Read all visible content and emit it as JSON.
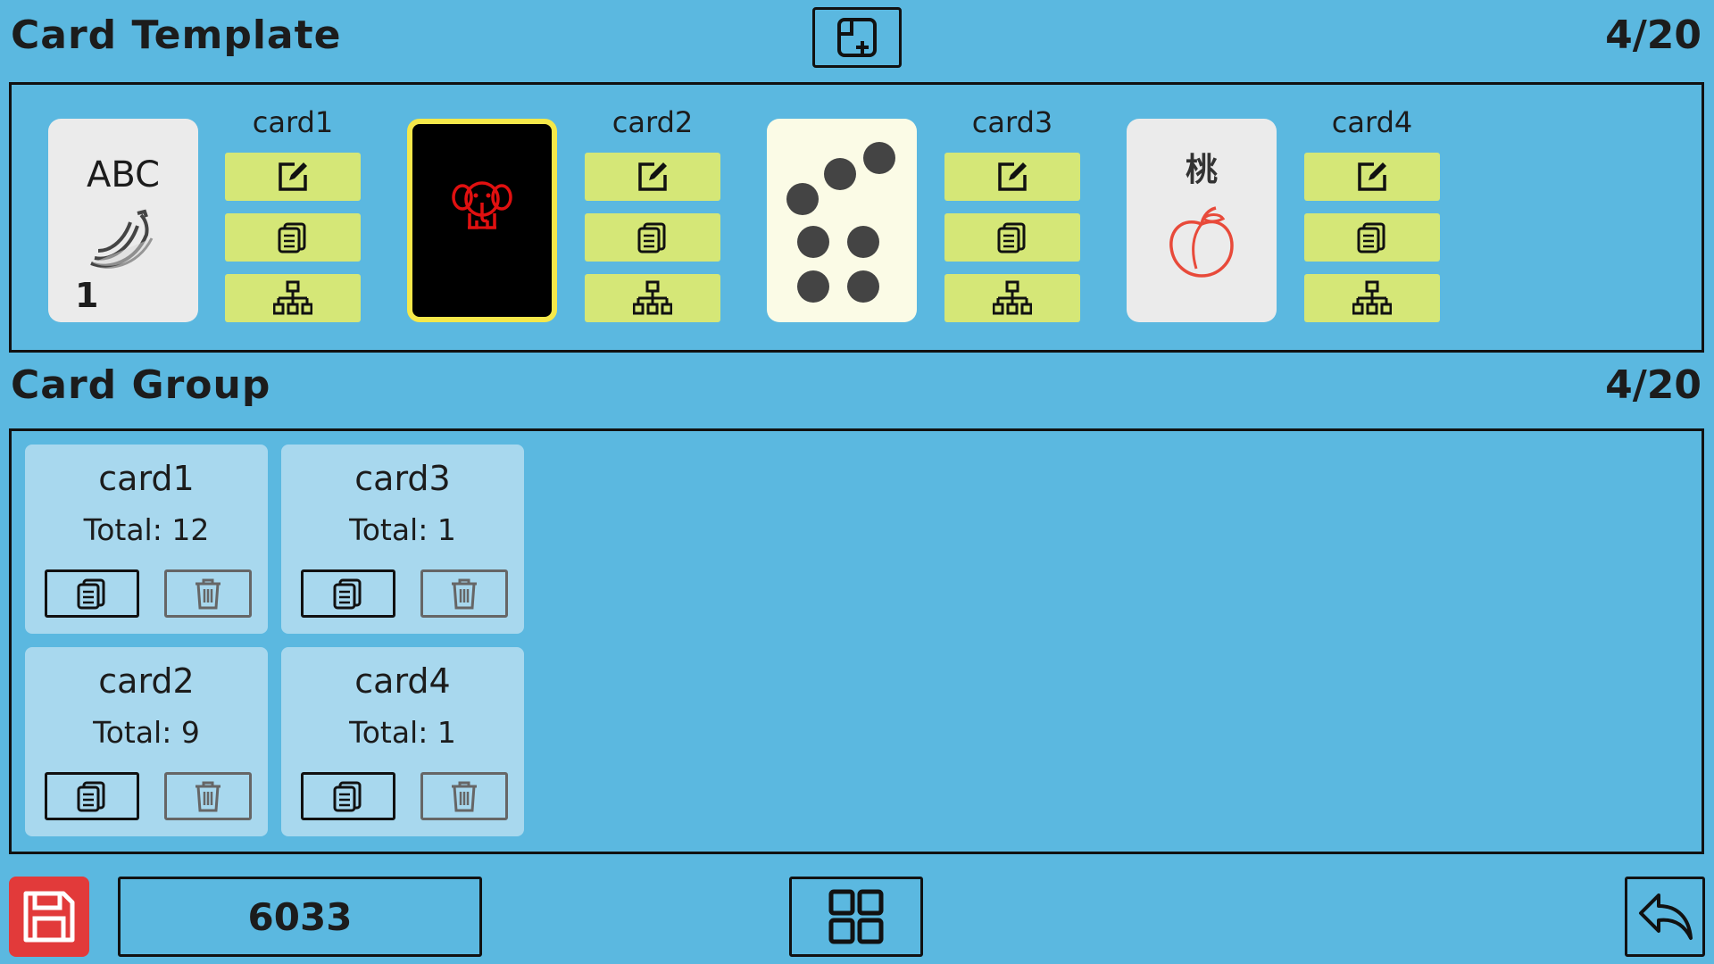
{
  "header": {
    "template_title": "Card Template",
    "template_count": "4/20",
    "group_title": "Card Group",
    "group_count": "4/20"
  },
  "templates": [
    {
      "name": "card1",
      "face": {
        "text": "ABC",
        "number": "1",
        "icon": "banana-icon"
      }
    },
    {
      "name": "card2",
      "face": {
        "icon": "elephant-icon",
        "selected": true
      }
    },
    {
      "name": "card3",
      "face": {
        "icon": "dots-icon"
      }
    },
    {
      "name": "card4",
      "face": {
        "text": "桃",
        "icon": "peach-icon"
      }
    }
  ],
  "template_buttons": [
    "edit-icon",
    "copy-icon",
    "hierarchy-icon"
  ],
  "groups": [
    {
      "name": "card1",
      "total": "Total: 12"
    },
    {
      "name": "card3",
      "total": "Total: 1"
    },
    {
      "name": "card2",
      "total": "Total: 9"
    },
    {
      "name": "card4",
      "total": "Total: 1"
    }
  ],
  "footer": {
    "code": "6033"
  },
  "colors": {
    "background": "#5bb8e0",
    "button_green": "#d5e777",
    "group_card": "#a8d8ee",
    "save_red": "#e23a3a",
    "selected_border": "#f5e84a"
  }
}
